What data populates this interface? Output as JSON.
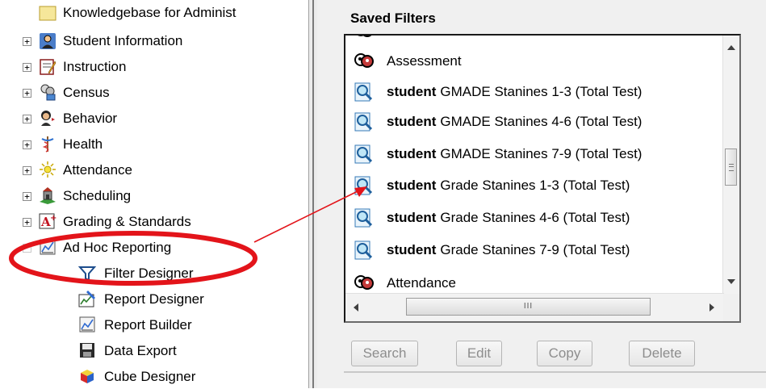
{
  "tree": {
    "items": [
      {
        "label": "Knowledgebase for Administ",
        "icon": "folder-icon",
        "expander": ""
      },
      {
        "label": "Student Information",
        "icon": "student-information-icon",
        "expander": "+"
      },
      {
        "label": "Instruction",
        "icon": "instruction-icon",
        "expander": "+"
      },
      {
        "label": "Census",
        "icon": "census-icon",
        "expander": "+"
      },
      {
        "label": "Behavior",
        "icon": "behavior-icon",
        "expander": "+"
      },
      {
        "label": "Health",
        "icon": "health-icon",
        "expander": "+"
      },
      {
        "label": "Attendance",
        "icon": "attendance-icon",
        "expander": "+"
      },
      {
        "label": "Scheduling",
        "icon": "scheduling-icon",
        "expander": "+"
      },
      {
        "label": "Grading & Standards",
        "icon": "grading-icon",
        "expander": "+"
      },
      {
        "label": "Ad Hoc Reporting",
        "icon": "ad-hoc-reporting-icon",
        "expander": ""
      }
    ],
    "children": [
      {
        "label": "Filter Designer",
        "icon": "funnel-icon"
      },
      {
        "label": "Report Designer",
        "icon": "report-designer-icon"
      },
      {
        "label": "Report Builder",
        "icon": "report-builder-icon"
      },
      {
        "label": "Data Export",
        "icon": "floppy-disk-icon"
      },
      {
        "label": "Cube Designer",
        "icon": "cube-icon"
      }
    ]
  },
  "saved_filters": {
    "title": "Saved Filters",
    "rows": [
      {
        "prefix": "",
        "text": "Assessment",
        "icon": "folder-people-icon"
      },
      {
        "prefix": "student",
        "text": "GMADE Stanines 1-3 (Total Test)",
        "icon": "magnifier-filter-icon"
      },
      {
        "prefix": "student",
        "text": "GMADE Stanines 4-6 (Total Test)",
        "icon": "magnifier-filter-icon"
      },
      {
        "prefix": "student",
        "text": "GMADE Stanines 7-9 (Total Test)",
        "icon": "magnifier-filter-icon"
      },
      {
        "prefix": "student",
        "text": "Grade Stanines 1-3 (Total Test)",
        "icon": "magnifier-filter-icon"
      },
      {
        "prefix": "student",
        "text": "Grade Stanines 4-6 (Total Test)",
        "icon": "magnifier-filter-icon"
      },
      {
        "prefix": "student",
        "text": "Grade Stanines 7-9 (Total Test)",
        "icon": "magnifier-filter-icon"
      },
      {
        "prefix": "",
        "text": "Attendance",
        "icon": "folder-people-icon"
      }
    ],
    "hscroll_grip": "III"
  },
  "buttons": {
    "search": "Search",
    "edit": "Edit",
    "copy": "Copy",
    "delete": "Delete"
  },
  "colors": {
    "annotation_red": "#e3141a",
    "selection": "#0a246a",
    "disabled_text": "#8d8d8d"
  }
}
